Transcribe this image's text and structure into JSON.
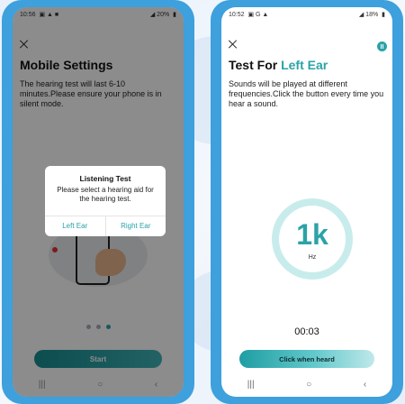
{
  "left_phone": {
    "status": {
      "time": "10:56",
      "battery": "20%"
    },
    "title": "Mobile Settings",
    "description": "The hearing test will last 6-10 minutes.Please ensure your phone is in silent mode.",
    "dialog": {
      "title": "Listening Test",
      "message": "Please select a hearing aid for the hearing test.",
      "left_button": "Left Ear",
      "right_button": "Right Ear"
    },
    "pager": {
      "count": 3,
      "active": 3
    },
    "start_label": "Start",
    "nav": {
      "recents": "|||",
      "home": "○",
      "back": "‹"
    }
  },
  "right_phone": {
    "status": {
      "time": "10:52",
      "battery": "18%"
    },
    "title_prefix": "Test For ",
    "title_accent": "Left Ear",
    "description": "Sounds will be played at different frequencies.Click the button every time you hear a sound.",
    "frequency": {
      "value": "1k",
      "unit": "Hz"
    },
    "timer": "00:03",
    "button_label": "Click when heard",
    "nav": {
      "recents": "|||",
      "home": "○",
      "back": "‹"
    }
  },
  "colors": {
    "accent": "#2aa3a8",
    "frame": "#3ea0dc"
  }
}
